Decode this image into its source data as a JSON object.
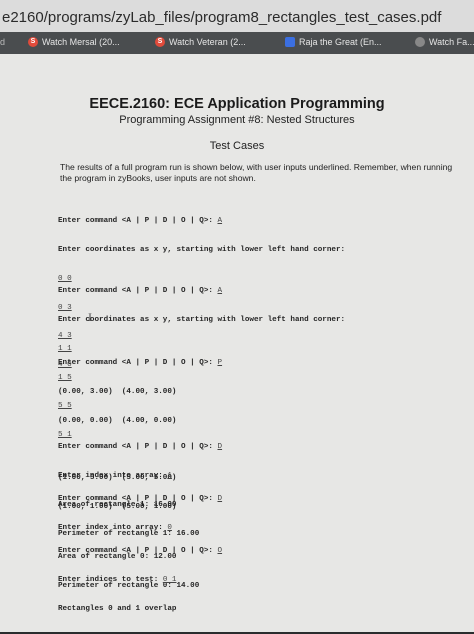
{
  "browser": {
    "url": "e2160/programs/zyLab_files/program8_rectangles_test_cases.pdf",
    "bookmarks": [
      {
        "label": "Watch Mersal (20...",
        "icon": "s-icon"
      },
      {
        "label": "Watch Veteran (2...",
        "icon": "s-icon"
      },
      {
        "label": "Raja the Great (En...",
        "icon": "bookmark-icon"
      },
      {
        "label": "Watch Fa...",
        "icon": "globe-icon"
      }
    ]
  },
  "doc": {
    "title": "EECE.2160: ECE Application Programming",
    "subtitle": "Programming Assignment #8: Nested Structures",
    "section": "Test Cases",
    "intro": "The results of a full program run is shown below, with user inputs underlined. Remember, when running the program in zyBooks, user inputs are not shown.",
    "block1": {
      "prompt": "Enter command <A | P | D | O | Q>: ",
      "input": "A",
      "coords_prompt": "Enter coordinates as x y, starting with lower left hand corner:",
      "coords": [
        "0 0",
        "0 3",
        "4 3",
        "4 0"
      ]
    },
    "block2": {
      "prompt": "Enter command <A | P | D | O | Q>: ",
      "input": "A",
      "coords_prompt": "Enter coordinates as x y, starting with lower left hand corner:",
      "coords": [
        "1 1",
        "1 5",
        "5 5",
        "5 1"
      ]
    },
    "block3": {
      "prompt": "Enter command <A | P | D | O | Q>: ",
      "input": "P",
      "lines": [
        "(0.00, 3.00)  (4.00, 3.00)",
        "(0.00, 0.00)  (4.00, 0.00)",
        "",
        "(1.00, 5.00)  (5.00, 5.00)",
        "(1.00, 1.00)  (5.00, 1.00)"
      ]
    },
    "block4": {
      "prompt": "Enter command <A | P | D | O | Q>: ",
      "input": "D",
      "index_prompt": "Enter index into array: ",
      "index": "1",
      "area": "Area of rectangle 1: 16.00",
      "perimeter": "Perimeter of rectangle 1: 16.00"
    },
    "block5": {
      "prompt": "Enter command <A | P | D | O | Q>: ",
      "input": "D",
      "index_prompt": "Enter index into array: ",
      "index": "0",
      "area": "Area of rectangle 0: 12.00",
      "perimeter": "Perimeter of rectangle 0: 14.00"
    },
    "block6": {
      "prompt": "Enter command <A | P | D | O | Q>: ",
      "input": "O",
      "indices_prompt": "Enter indices to test: ",
      "indices": "0 1",
      "result": "Rectangles 0 and 1 overlap"
    }
  }
}
